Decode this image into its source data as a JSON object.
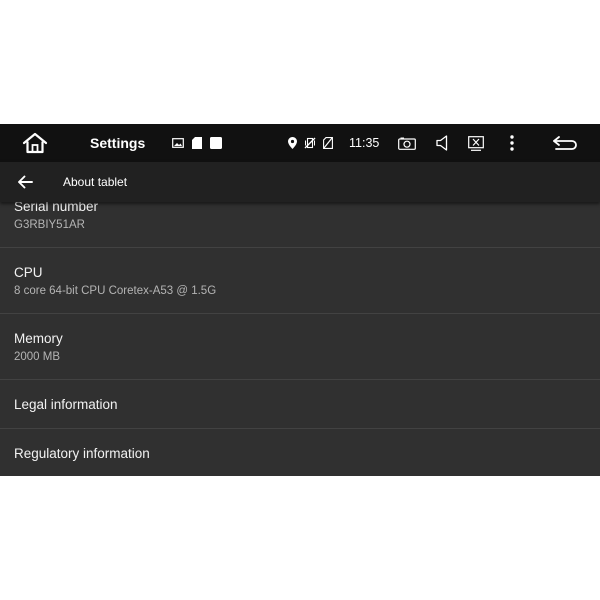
{
  "status_bar": {
    "app_label": "Settings",
    "clock": "11:35"
  },
  "app_bar": {
    "title": "About tablet"
  },
  "items": [
    {
      "title": "Serial number",
      "summary": "G3RBIY51AR"
    },
    {
      "title": "CPU",
      "summary": "8 core 64-bit CPU Coretex-A53 @ 1.5G"
    },
    {
      "title": "Memory",
      "summary": "2000 MB"
    },
    {
      "title": "Legal information"
    },
    {
      "title": "Regulatory information"
    }
  ],
  "colors": {
    "status_bar_bg": "#111111",
    "app_bar_bg": "#212121",
    "content_bg": "#303030",
    "divider": "#424242"
  }
}
